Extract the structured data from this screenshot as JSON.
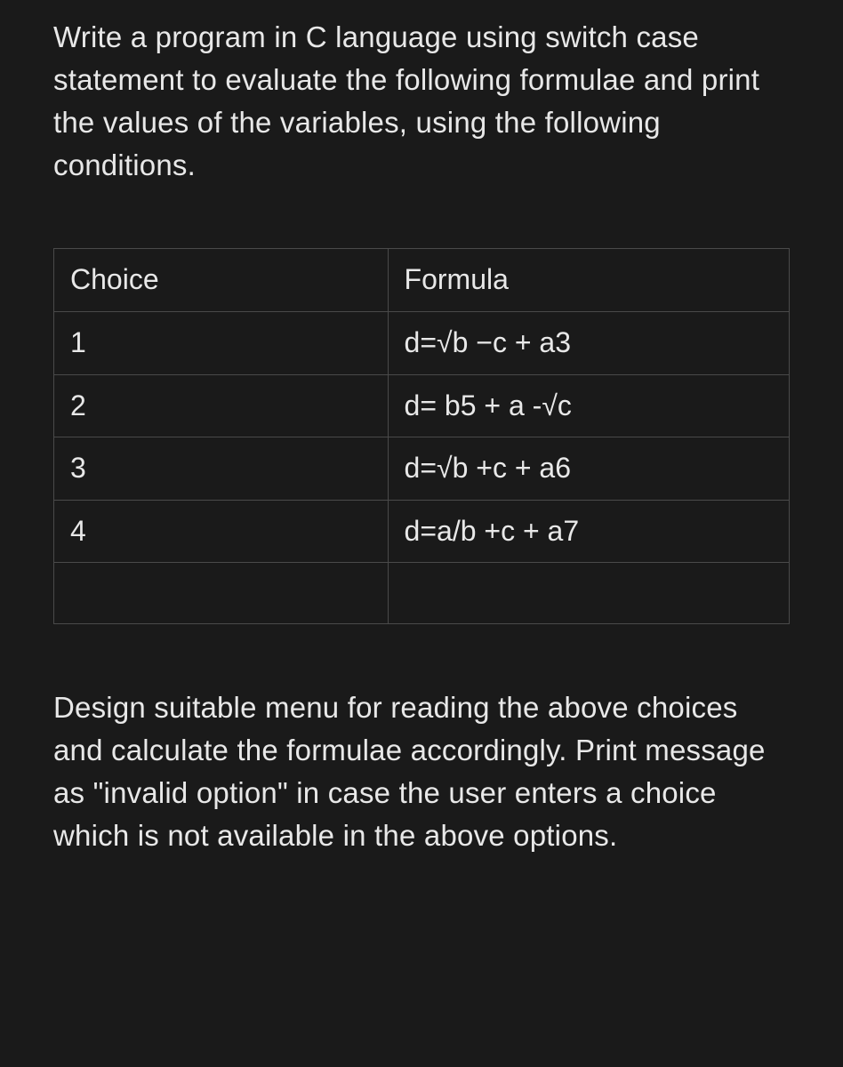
{
  "intro": "Write a program in C language using switch case statement to evaluate the following formulae and print the values of the variables, using the following conditions.",
  "table": {
    "headers": {
      "col1": "Choice",
      "col2": "Formula"
    },
    "rows": [
      {
        "choice": "1",
        "formula": "d=√b −c + a3"
      },
      {
        "choice": "2",
        "formula": "d= b5 + a   -√c"
      },
      {
        "choice": "3",
        "formula": "d=√b +c + a6"
      },
      {
        "choice": "4",
        "formula": "d=a/b +c + a7"
      },
      {
        "choice": "",
        "formula": ""
      }
    ]
  },
  "outro": "Design suitable menu for reading the above choices and calculate the formulae accordingly. Print message as \"invalid option\" in case the user enters a choice which is not available in the above options."
}
